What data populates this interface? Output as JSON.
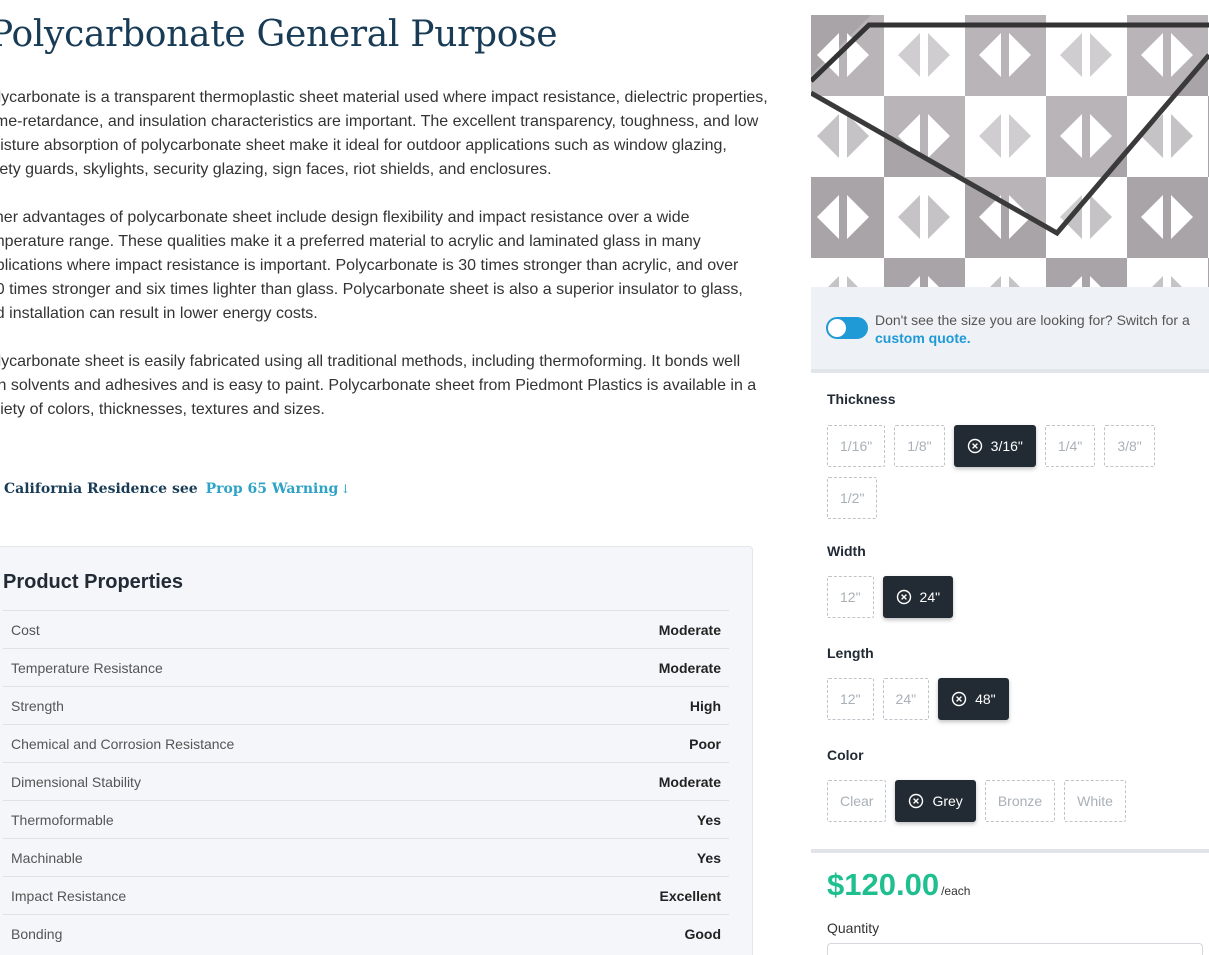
{
  "product": {
    "title": "Polycarbonate General Purpose",
    "paragraphs": [
      "Polycarbonate is a transparent thermoplastic sheet material used where impact resistance, dielectric properties, flame-retardance, and insulation characteristics are important. The excellent transparency, toughness, and low moisture absorption of polycarbonate sheet make it ideal for outdoor applications such as window glazing, safety guards, skylights, security glazing, sign faces, riot shields, and enclosures.",
      "Other advantages of polycarbonate sheet include design flexibility and impact resistance over a wide temperature range. These qualities make it a preferred material to acrylic and laminated glass in many applications where impact resistance is important. Polycarbonate is 30 times stronger than acrylic, and over 200 times stronger and six times lighter than glass. Polycarbonate sheet is also a superior insulator to glass, and installation can result in lower energy costs.",
      "Polycarbonate sheet is easily fabricated using all traditional methods, including thermoforming. It bonds well with solvents and adhesives and is easy to paint. Polycarbonate sheet from Piedmont Plastics is available in a variety of colors, thicknesses, textures and sizes."
    ]
  },
  "prop65": {
    "label": "California Residence see",
    "link": "Prop 65 Warning",
    "arrow": "↓"
  },
  "properties": {
    "heading": "Product Properties",
    "rows": [
      {
        "name": "Cost",
        "value": "Moderate"
      },
      {
        "name": "Temperature Resistance",
        "value": "Moderate"
      },
      {
        "name": "Strength",
        "value": "High"
      },
      {
        "name": "Chemical and Corrosion Resistance",
        "value": "Poor"
      },
      {
        "name": "Dimensional Stability",
        "value": "Moderate"
      },
      {
        "name": "Thermoformable",
        "value": "Yes"
      },
      {
        "name": "Machinable",
        "value": "Yes"
      },
      {
        "name": "Impact Resistance",
        "value": "Excellent"
      },
      {
        "name": "Bonding",
        "value": "Good"
      }
    ]
  },
  "custom_quote": {
    "text": "Don't see the size you are looking for? Switch for a",
    "link": "custom quote."
  },
  "options": {
    "thickness": {
      "label": "Thickness",
      "values": [
        "1/16\"",
        "1/8\"",
        "3/16\"",
        "1/4\"",
        "3/8\"",
        "1/2\""
      ],
      "selected": "3/16\""
    },
    "width": {
      "label": "Width",
      "values": [
        "12\"",
        "24\""
      ],
      "selected": "24\""
    },
    "length": {
      "label": "Length",
      "values": [
        "12\"",
        "24\"",
        "48\""
      ],
      "selected": "48\""
    },
    "color": {
      "label": "Color",
      "values": [
        "Clear",
        "Grey",
        "Bronze",
        "White"
      ],
      "selected": "Grey"
    }
  },
  "price": {
    "amount": "$120.00",
    "unit": "/each"
  },
  "quantity": {
    "label": "Quantity"
  },
  "theme": {
    "accent": "#1f9ad6",
    "price": "#1fbf8f",
    "heading": "#183b56",
    "selected": "#222b33"
  }
}
